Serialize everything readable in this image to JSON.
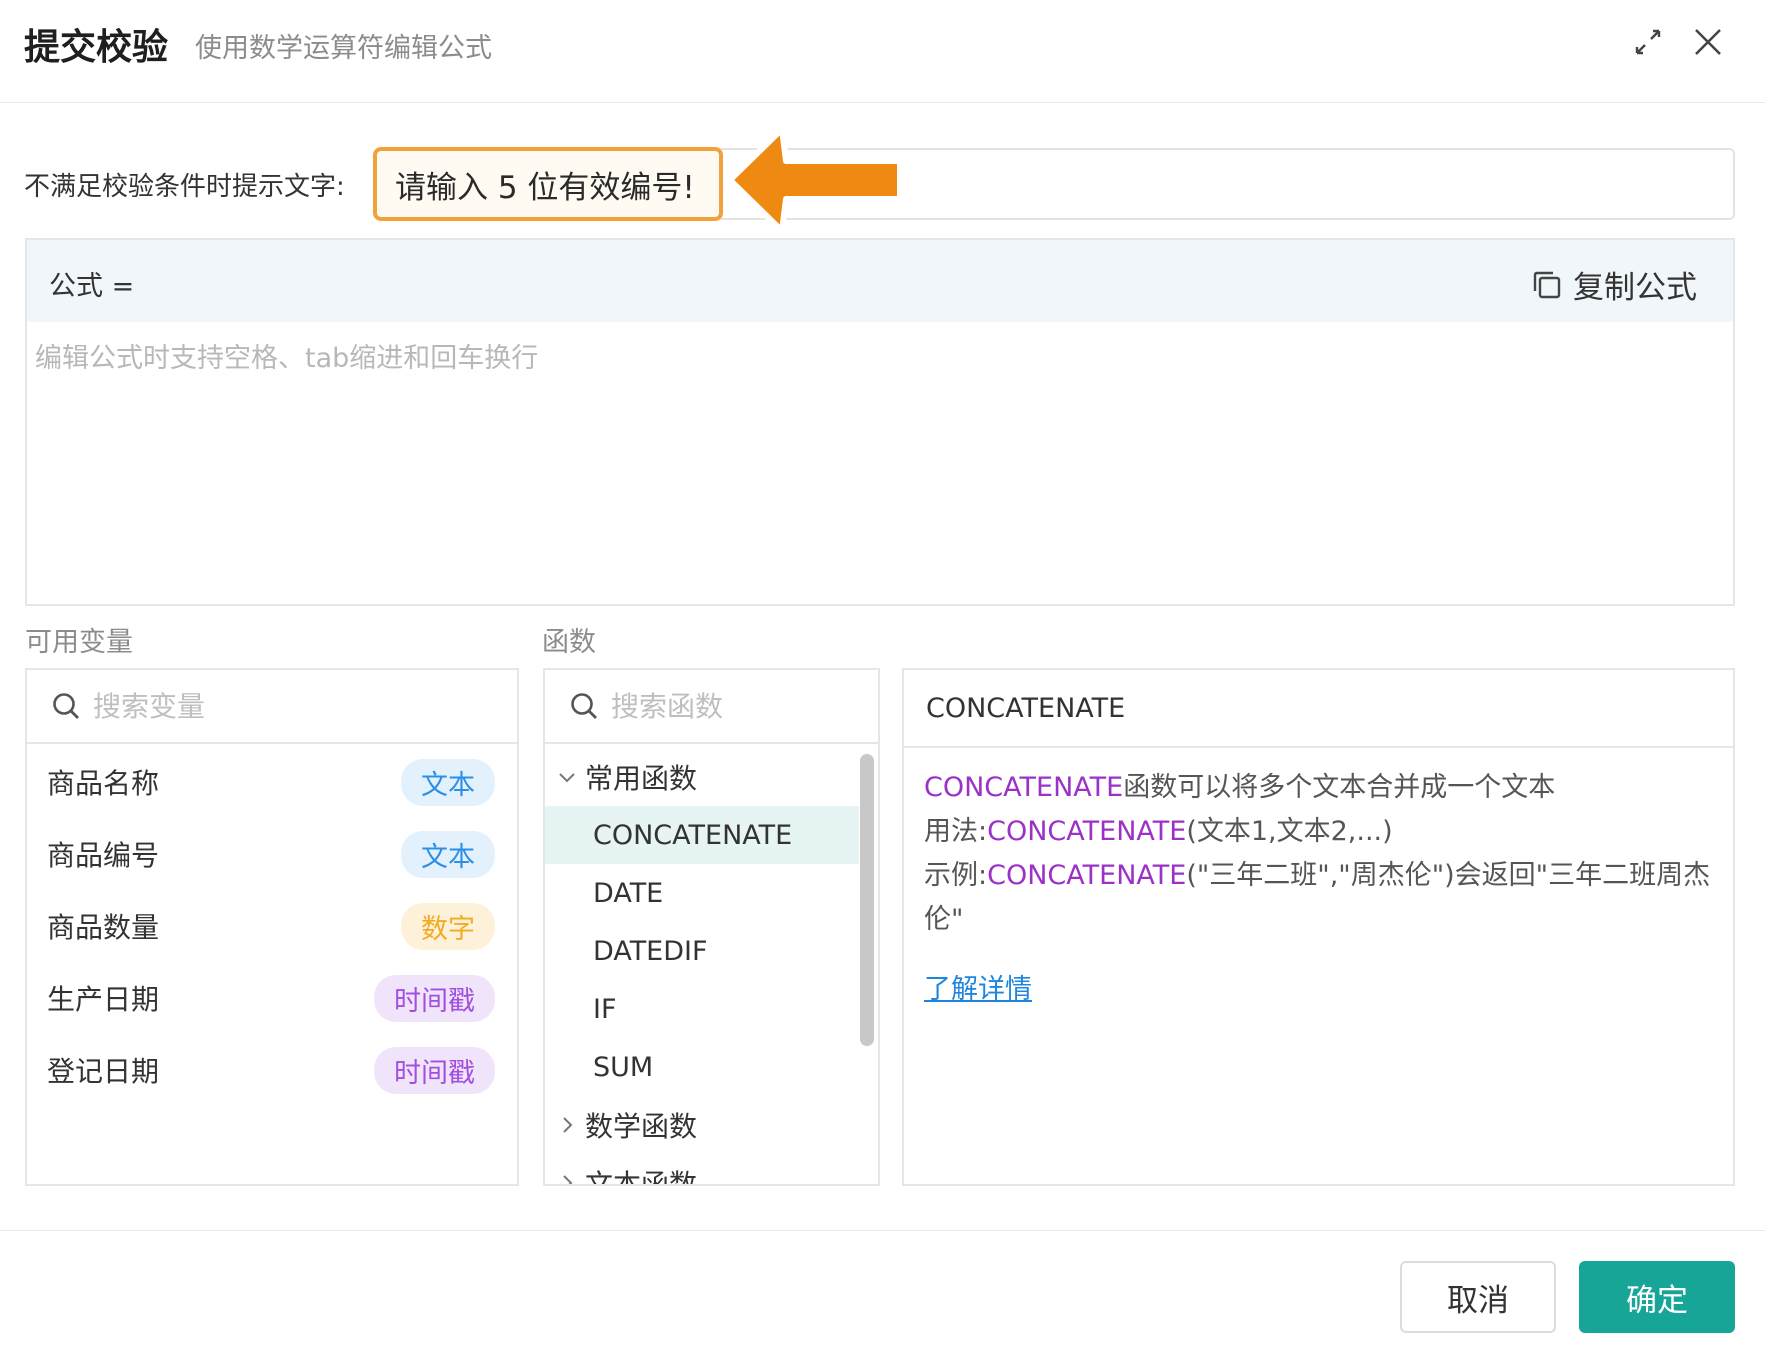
{
  "dialog": {
    "title": "提交校验",
    "subtitle": "使用数学运算符编辑公式"
  },
  "hint": {
    "label": "不满足校验条件时提示文字:",
    "value": "请输入 5 位有效编号!"
  },
  "formula": {
    "label": "公式 =",
    "copy_label": "复制公式",
    "placeholder": "编辑公式时支持空格、tab缩进和回车换行"
  },
  "variables": {
    "section_label": "可用变量",
    "search_placeholder": "搜索变量",
    "items": [
      {
        "name": "商品名称",
        "type": "文本"
      },
      {
        "name": "商品编号",
        "type": "文本"
      },
      {
        "name": "商品数量",
        "type": "数字"
      },
      {
        "name": "生产日期",
        "type": "时间戳"
      },
      {
        "name": "登记日期",
        "type": "时间戳"
      }
    ]
  },
  "functions": {
    "section_label": "函数",
    "search_placeholder": "搜索函数",
    "groups": [
      {
        "label": "常用函数",
        "items": [
          "CONCATENATE",
          "DATE",
          "DATEDIF",
          "IF",
          "SUM"
        ]
      },
      {
        "label": "数学函数"
      },
      {
        "label": "文本函数"
      }
    ],
    "selected": "CONCATENATE"
  },
  "detail": {
    "name": "CONCATENATE",
    "desc_fn": "CONCATENATE",
    "desc_text": "函数可以将多个文本合并成一个文本",
    "usage_label": "用法:",
    "usage_fn": "CONCATENATE",
    "usage_args": "(文本1,文本2,...)",
    "example_label": "示例:",
    "example_fn": "CONCATENATE",
    "example_text": "(\"三年二班\",\"周杰伦\")会返回\"三年二班周杰伦\"",
    "link": "了解详情"
  },
  "footer": {
    "cancel": "取消",
    "ok": "确定"
  },
  "colors": {
    "accent": "#17a598",
    "highlight": "#f0a33a",
    "function": "#9c31c8",
    "link": "#1f86e0"
  }
}
